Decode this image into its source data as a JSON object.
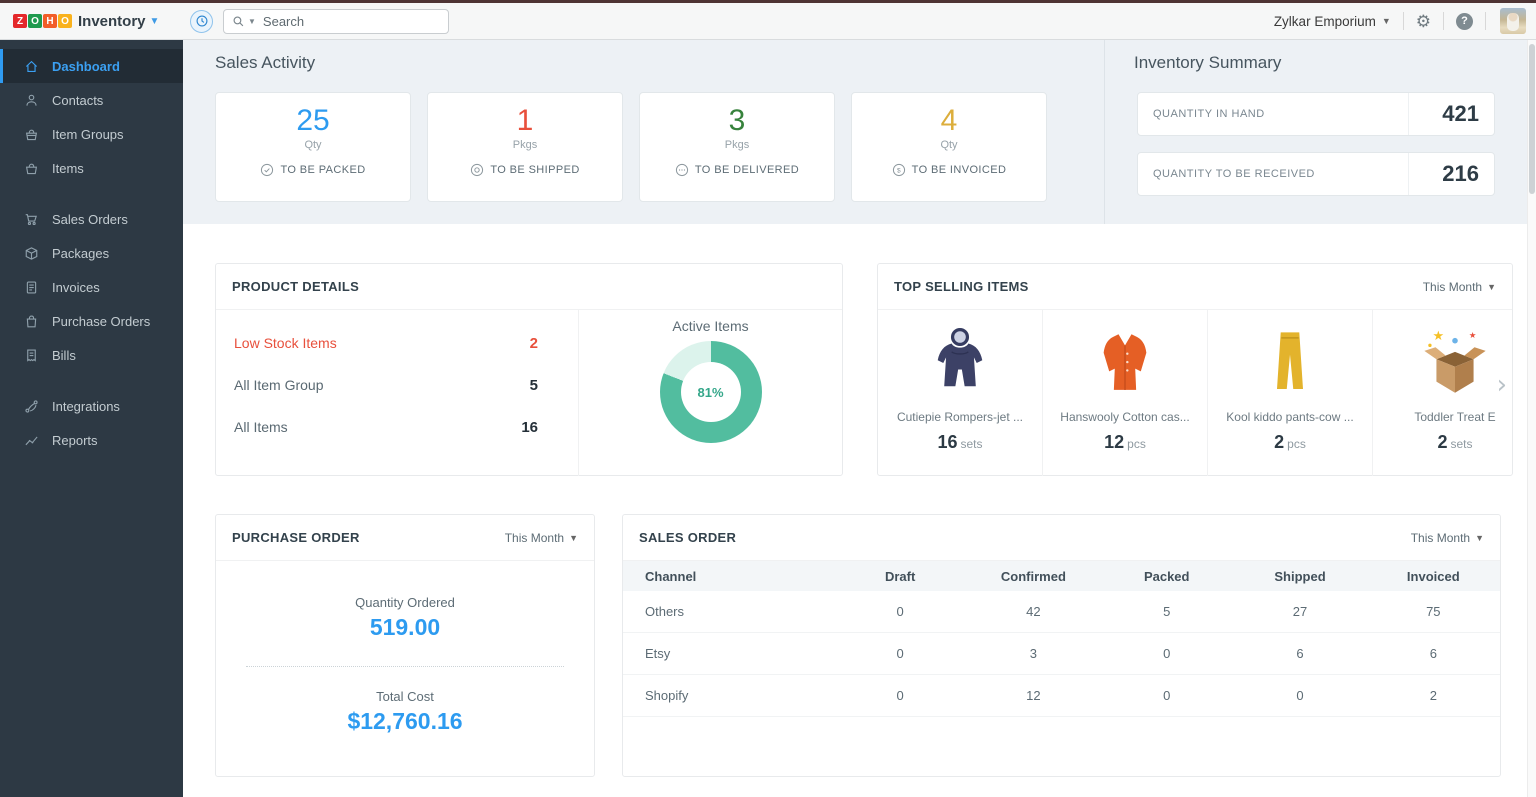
{
  "topbar": {
    "logo_letters": [
      {
        "ch": "Z",
        "color": "#e4282b"
      },
      {
        "ch": "O",
        "color": "#1f9a4e"
      },
      {
        "ch": "H",
        "color": "#f25e29"
      },
      {
        "ch": "O",
        "color": "#f9b21d"
      }
    ],
    "app_name": "Inventory",
    "search_placeholder": "Search",
    "org_name": "Zylkar Emporium",
    "help_glyph": "?",
    "gear_glyph": "⚙"
  },
  "sidebar": {
    "items": [
      {
        "label": "Dashboard"
      },
      {
        "label": "Contacts"
      },
      {
        "label": "Item Groups"
      },
      {
        "label": "Items"
      },
      {
        "label": "Sales Orders"
      },
      {
        "label": "Packages"
      },
      {
        "label": "Invoices"
      },
      {
        "label": "Purchase Orders"
      },
      {
        "label": "Bills"
      },
      {
        "label": "Integrations"
      },
      {
        "label": "Reports"
      }
    ]
  },
  "sales_activity": {
    "title": "Sales Activity",
    "cards": [
      {
        "value": "25",
        "unit": "Qty",
        "label": "TO BE PACKED",
        "color": "#2d9bf0"
      },
      {
        "value": "1",
        "unit": "Pkgs",
        "label": "TO BE SHIPPED",
        "color": "#e8503c"
      },
      {
        "value": "3",
        "unit": "Pkgs",
        "label": "TO BE DELIVERED",
        "color": "#37823c"
      },
      {
        "value": "4",
        "unit": "Qty",
        "label": "TO BE INVOICED",
        "color": "#dcae3c"
      }
    ]
  },
  "inventory_summary": {
    "title": "Inventory Summary",
    "rows": [
      {
        "label": "QUANTITY IN HAND",
        "value": "421"
      },
      {
        "label": "QUANTITY TO BE RECEIVED",
        "value": "216"
      }
    ]
  },
  "product_details": {
    "title": "PRODUCT DETAILS",
    "rows": [
      {
        "label": "Low Stock Items",
        "value": "2",
        "color": "#e8503c"
      },
      {
        "label": "All Item Group",
        "value": "5",
        "color": "#5a6972"
      },
      {
        "label": "All Items",
        "value": "16",
        "color": "#5a6972"
      }
    ],
    "chart": {
      "type": "donut",
      "label": "Active Items",
      "percent": 81,
      "percent_label": "81%",
      "color": "#52bd9f",
      "track_color": "#dcf3ec"
    }
  },
  "top_selling": {
    "title": "TOP SELLING ITEMS",
    "filter": "This Month",
    "next_glyph": "›",
    "items": [
      {
        "name": "Cutiepie Rompers-jet ...",
        "qty": "16",
        "unit": "sets"
      },
      {
        "name": "Hanswooly Cotton cas...",
        "qty": "12",
        "unit": "pcs"
      },
      {
        "name": "Kool kiddo pants-cow ...",
        "qty": "2",
        "unit": "pcs"
      },
      {
        "name": "Toddler Treat E",
        "qty": "2",
        "unit": "sets"
      }
    ]
  },
  "purchase_order": {
    "title": "PURCHASE ORDER",
    "filter": "This Month",
    "value_color": "#2d9bf0",
    "metrics": [
      {
        "label": "Quantity Ordered",
        "value": "519.00"
      },
      {
        "label": "Total Cost",
        "value": "$12,760.16"
      }
    ]
  },
  "sales_order": {
    "title": "SALES ORDER",
    "filter": "This Month",
    "columns": [
      "Channel",
      "Draft",
      "Confirmed",
      "Packed",
      "Shipped",
      "Invoiced"
    ],
    "rows": [
      [
        "Others",
        "0",
        "42",
        "5",
        "27",
        "75"
      ],
      [
        "Etsy",
        "0",
        "3",
        "0",
        "6",
        "6"
      ],
      [
        "Shopify",
        "0",
        "12",
        "0",
        "0",
        "2"
      ]
    ]
  }
}
